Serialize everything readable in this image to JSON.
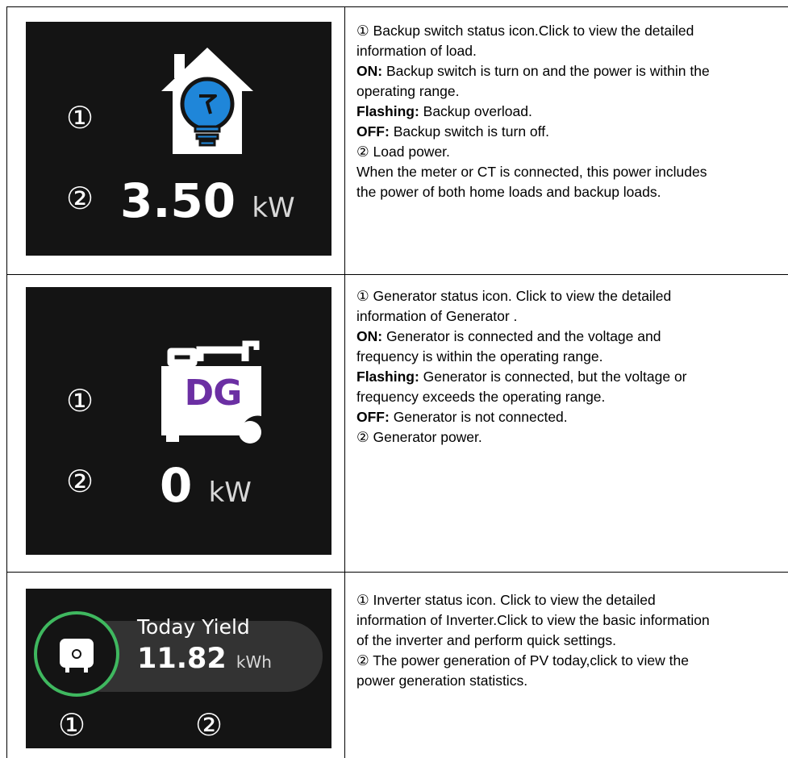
{
  "rows": [
    {
      "marker1": "①",
      "marker2": "②",
      "value": "3.50",
      "unit": "kW",
      "icon": "house-bulb-icon",
      "desc": {
        "l1": "① Backup switch status icon.Click to view the detailed",
        "l2": "information of load.",
        "l3_bold": "ON:",
        "l3": " Backup switch is turn on and the power is within the",
        "l4": "operating range.",
        "l5_bold": "Flashing:",
        "l5": " Backup overload.",
        "l6_bold": "OFF:",
        "l6": " Backup switch is turn off.",
        "l7": "② Load power.",
        "l8": "When the meter or CT  is connected, this power includes",
        "l9": "the power of both home loads and backup loads."
      }
    },
    {
      "marker1": "①",
      "marker2": "②",
      "value": "0",
      "unit": "kW",
      "icon": "generator-icon",
      "icon_text": "DG",
      "desc": {
        "l1": "① Generator status icon. Click to view the detailed",
        "l2": "information of Generator .",
        "l3_bold": "ON:",
        "l3": " Generator is connected and the voltage and",
        "l4": "frequency is within the operating range.",
        "l5_bold": "Flashing:",
        "l5": " Generator is connected, but the voltage or",
        "l6": "frequency exceeds the operating range.",
        "l7_bold": "OFF:",
        "l7": " Generator is not connected.",
        "l8": "② Generator power."
      }
    },
    {
      "marker1": "①",
      "marker2": "②",
      "label": "Today Yield",
      "value": "11.82",
      "unit": "kWh",
      "icon": "inverter-icon",
      "accent": "#3fb85f",
      "desc": {
        "l1": "① Inverter status icon. Click to view the detailed",
        "l2": "information of Inverter.Click to view the basic information",
        "l3": "of the inverter and perform quick settings.",
        "l4": "② The power generation of PV today,click to view the",
        "l5": "power generation statistics."
      }
    }
  ]
}
